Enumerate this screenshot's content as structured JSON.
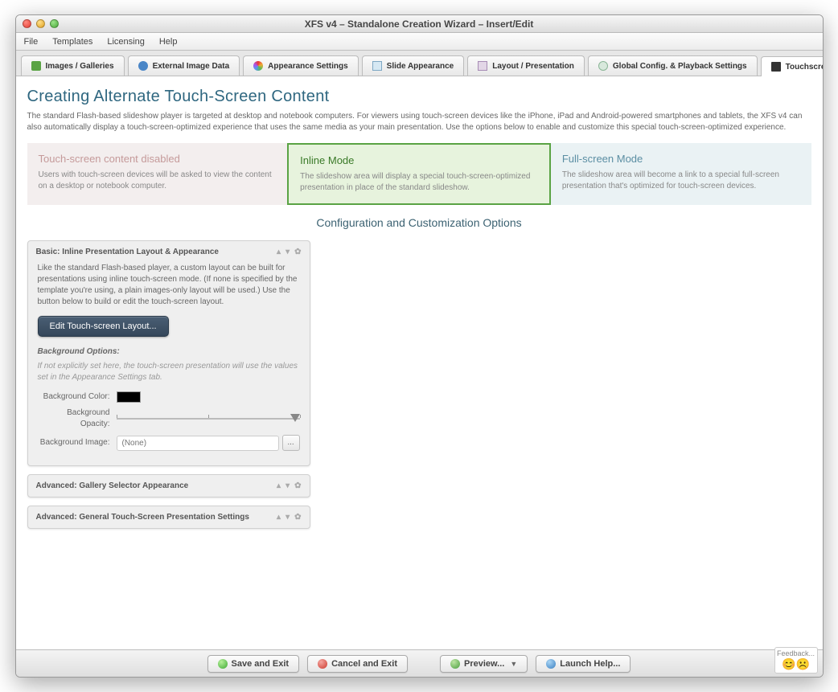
{
  "window": {
    "title": "XFS v4 – Standalone Creation Wizard – Insert/Edit"
  },
  "menu": {
    "file": "File",
    "templates": "Templates",
    "licensing": "Licensing",
    "help": "Help"
  },
  "tabs": {
    "images": "Images / Galleries",
    "external": "External Image Data",
    "appearance": "Appearance Settings",
    "slide": "Slide Appearance",
    "layout": "Layout / Presentation",
    "global": "Global Config. & Playback Settings",
    "touch": "Touchscreen Content"
  },
  "page": {
    "title": "Creating Alternate Touch-Screen Content",
    "lead": "The standard Flash-based slideshow player is targeted at desktop and notebook computers.  For viewers using touch-screen devices like the iPhone, iPad and Android-powered smartphones and tablets, the XFS v4 can also automatically display a touch-screen-optimized experience that uses the same media as your main presentation.  Use the options below to enable and customize this special touch-screen-optimized experience."
  },
  "modes": {
    "disabled": {
      "title": "Touch-screen content disabled",
      "desc": "Users with touch-screen devices will be asked to view the content on a desktop or notebook computer."
    },
    "inline": {
      "title": "Inline Mode",
      "desc": "The slideshow area will display a special touch-screen-optimized presentation in place of the standard slideshow."
    },
    "full": {
      "title": "Full-screen Mode",
      "desc": "The slideshow area will become a link to a special full-screen presentation that's optimized for touch-screen devices."
    }
  },
  "subhead": "Configuration and Customization Options",
  "basic": {
    "title": "Basic: Inline Presentation Layout & Appearance",
    "desc": "Like the standard Flash-based player, a custom layout can be built for presentations using inline touch-screen mode.  (If none is specified by the template you're using, a plain images-only layout will be used.)  Use the button below to build or edit the touch-screen layout.",
    "button": "Edit Touch-screen Layout...",
    "bg_label": "Background Options:",
    "bg_note": "If not explicitly set here, the touch-screen presentation will use the values set in the Appearance Settings tab.",
    "color_label": "Background Color:",
    "opacity_label": "Background Opacity:",
    "image_label": "Background Image:",
    "image_placeholder": "(None)"
  },
  "adv_gallery": {
    "title": "Advanced: Gallery Selector Appearance"
  },
  "adv_general": {
    "title": "Advanced: General Touch-Screen Presentation Settings"
  },
  "footer": {
    "save": "Save and Exit",
    "cancel": "Cancel and Exit",
    "preview": "Preview...",
    "help": "Launch Help...",
    "feedback": "Feedback..."
  }
}
